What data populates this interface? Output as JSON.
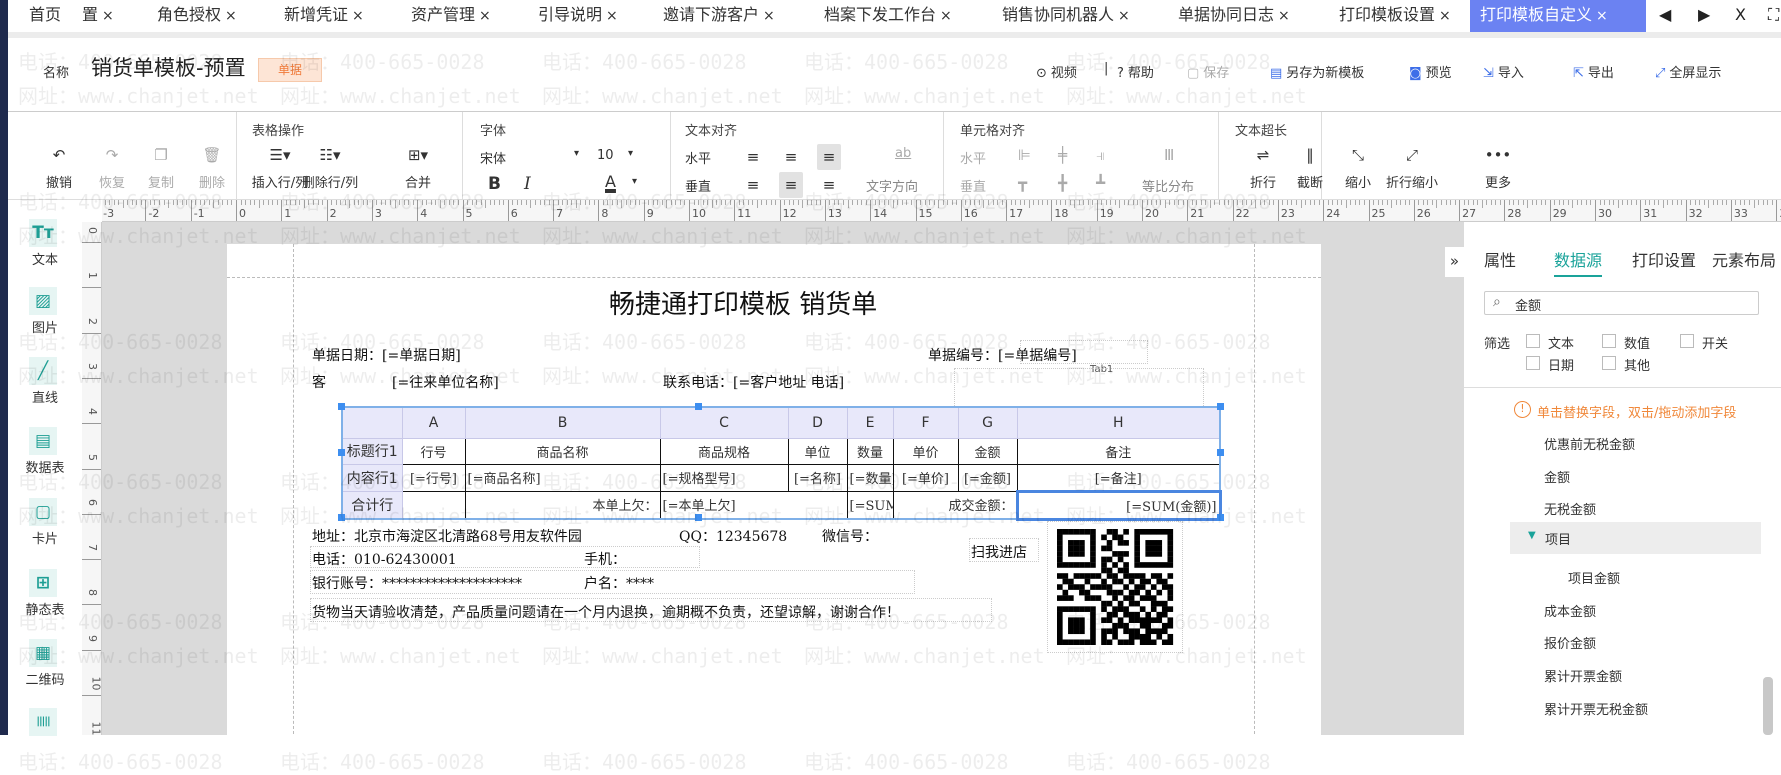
{
  "tabs": [
    {
      "label": "首页",
      "closable": false
    },
    {
      "label": "置",
      "closable": true
    },
    {
      "label": "角色授权",
      "closable": true
    },
    {
      "label": "新增凭证",
      "closable": true
    },
    {
      "label": "资产管理",
      "closable": true
    },
    {
      "label": "引导说明",
      "closable": true
    },
    {
      "label": "邀请下游客户",
      "closable": true
    },
    {
      "label": "档案下发工作台",
      "closable": true
    },
    {
      "label": "销售协同机器人",
      "closable": true
    },
    {
      "label": "单据协同日志",
      "closable": true
    },
    {
      "label": "打印模板设置",
      "closable": true
    },
    {
      "label": "打印模板自定义",
      "closable": true,
      "active": true
    }
  ],
  "tab_close": "×",
  "tab_nav": {
    "prev": "◀",
    "next": "▶",
    "close_all": "X",
    "fullscreen": "⛶"
  },
  "header": {
    "name_label": "名称",
    "template_name": "销货单模板-预置",
    "badge": "单据",
    "actions": [
      {
        "icon": "⊙",
        "label": "视频",
        "name": "video"
      },
      {
        "icon": "?",
        "label": "帮助",
        "name": "help"
      },
      {
        "icon": "▢",
        "label": "保存",
        "name": "save",
        "disabled": true
      },
      {
        "icon": "▤",
        "label": "另存为新模板",
        "name": "save-as-new-template"
      },
      {
        "icon": "◙",
        "label": "预览",
        "name": "preview"
      },
      {
        "icon": "⇲",
        "label": "导入",
        "name": "import"
      },
      {
        "icon": "⇱",
        "label": "导出",
        "name": "export"
      },
      {
        "icon": "⤢",
        "label": "全屏显示",
        "name": "fullscreen"
      }
    ],
    "separator": "|"
  },
  "toolbar": {
    "edit": [
      {
        "icon": "↶",
        "label": "撤销",
        "name": "undo"
      },
      {
        "icon": "↷",
        "label": "恢复",
        "name": "redo",
        "disabled": true
      },
      {
        "icon": "❐",
        "label": "复制",
        "name": "copy",
        "disabled": true
      },
      {
        "icon": "🗑",
        "label": "删除",
        "name": "delete",
        "disabled": true
      }
    ],
    "table_ops": {
      "title": "表格操作",
      "items": [
        {
          "icon": "☰▾",
          "label": "插入行/列",
          "name": "insert-row-col"
        },
        {
          "icon": "☷▾",
          "label": "删除行/列",
          "name": "delete-row-col"
        },
        {
          "icon": "⊞▾",
          "label": "合并",
          "name": "merge"
        }
      ]
    },
    "font": {
      "title": "字体",
      "family": "宋体",
      "size": "10",
      "bold": "B",
      "italic": "I",
      "color": "A",
      "dropdown": "▾"
    },
    "text_align": {
      "title": "文本对齐",
      "horizontal": "水平",
      "vertical": "垂直",
      "direction": "文字方向",
      "direction_icon": "ab"
    },
    "cell_align": {
      "title": "单元格对齐",
      "horizontal": "水平",
      "vertical": "垂直",
      "distribute": "等比分布"
    },
    "overflow": {
      "title": "文本超长",
      "items": [
        {
          "icon": "⇌",
          "label": "折行",
          "name": "wrap"
        },
        {
          "icon": "‖",
          "label": "截断",
          "name": "truncate"
        },
        {
          "icon": "⤡",
          "label": "缩小",
          "name": "shrink"
        },
        {
          "icon": "⤢",
          "label": "折行缩小",
          "name": "wrap-shrink"
        }
      ]
    },
    "more": {
      "icon": "•••",
      "label": "更多"
    }
  },
  "sidebar": [
    {
      "icon": "Tт",
      "label": "文本",
      "name": "text"
    },
    {
      "icon": "▨",
      "label": "图片",
      "name": "image"
    },
    {
      "icon": "╱",
      "label": "直线",
      "name": "line"
    },
    {
      "icon": "▤",
      "label": "数据表",
      "name": "data-table"
    },
    {
      "icon": "▢",
      "label": "卡片",
      "name": "card"
    },
    {
      "icon": "⊞",
      "label": "静态表",
      "name": "static-table"
    },
    {
      "icon": "▦",
      "label": "二维码",
      "name": "qrcode"
    },
    {
      "icon": "|||||",
      "label": "",
      "name": "barcode"
    }
  ],
  "ruler": {
    "h_from": -3,
    "h_to": 34,
    "v_from": 0,
    "v_to": 11
  },
  "watermark": {
    "phone": "电话：400-665-0028",
    "site": "网址：www.chanjet.net"
  },
  "paper": {
    "title": "畅捷通打印模板 销货单",
    "doc_date": "单据日期：[=单据日期]",
    "doc_no": "单据编号：[=单据编号]",
    "tab_hint": "Tab1",
    "partial_row": {
      "customer": "客",
      "customer_val": "[=往来单位名称]",
      "contact": "联系电话：[=客户地址 电话]"
    },
    "table": {
      "columns": [
        "A",
        "B",
        "C",
        "D",
        "E",
        "F",
        "G",
        "H"
      ],
      "rows": [
        {
          "label": "标题行1",
          "cells": [
            "行号",
            "商品名称",
            "商品规格",
            "单位",
            "数量",
            "单价",
            "金额",
            "备注"
          ]
        },
        {
          "label": "内容行1",
          "cells": [
            "[=行号]",
            "[=商品名称]",
            "[=规格型号]",
            "[=名称]",
            "[=数量]",
            "[=单价]",
            "[=金额]",
            "[=备注]"
          ]
        },
        {
          "label": "合计行",
          "cells": [
            "",
            "本单上欠：",
            "[=本单上欠]",
            "",
            "[=SUM(数",
            "成交金额：",
            "",
            "[=SUM(金额)]"
          ]
        }
      ]
    },
    "address": "地址：北京市海淀区北清路68号用友软件园",
    "qq": "QQ：12345678",
    "wechat": "微信号：",
    "phone": "电话：010-62430001",
    "mobile": "手机：",
    "bank": "银行账号：********************",
    "account_name": "户名：****",
    "notice": "货物当天请验收清楚，产品质量问题请在一个月内退换，逾期概不负责，还望谅解，谢谢合作！",
    "scan": "扫我进店"
  },
  "right_panel": {
    "collapse": "»",
    "tabs": [
      {
        "label": "属性"
      },
      {
        "label": "数据源",
        "active": true
      },
      {
        "label": "打印设置"
      },
      {
        "label": "元素布局"
      }
    ],
    "search_value": "金额",
    "filter_label": "筛选",
    "filters": [
      "文本",
      "数值",
      "开关",
      "日期",
      "其他"
    ],
    "hint": "单击替换字段，双击/拖动添加字段",
    "fields": [
      {
        "label": "优惠前无税金额"
      },
      {
        "label": "金额"
      },
      {
        "label": "无税金额"
      },
      {
        "label": "项目",
        "group": true,
        "expanded": true
      },
      {
        "label": "项目金额",
        "indent": true
      },
      {
        "label": "成本金额"
      },
      {
        "label": "报价金额"
      },
      {
        "label": "累计开票金额"
      },
      {
        "label": "累计开票无税金额"
      }
    ]
  },
  "colors": {
    "accent": "#1aa39a",
    "active_tab": "#6b82f2",
    "warning": "#f0883a",
    "selection": "#3d8ef0"
  }
}
